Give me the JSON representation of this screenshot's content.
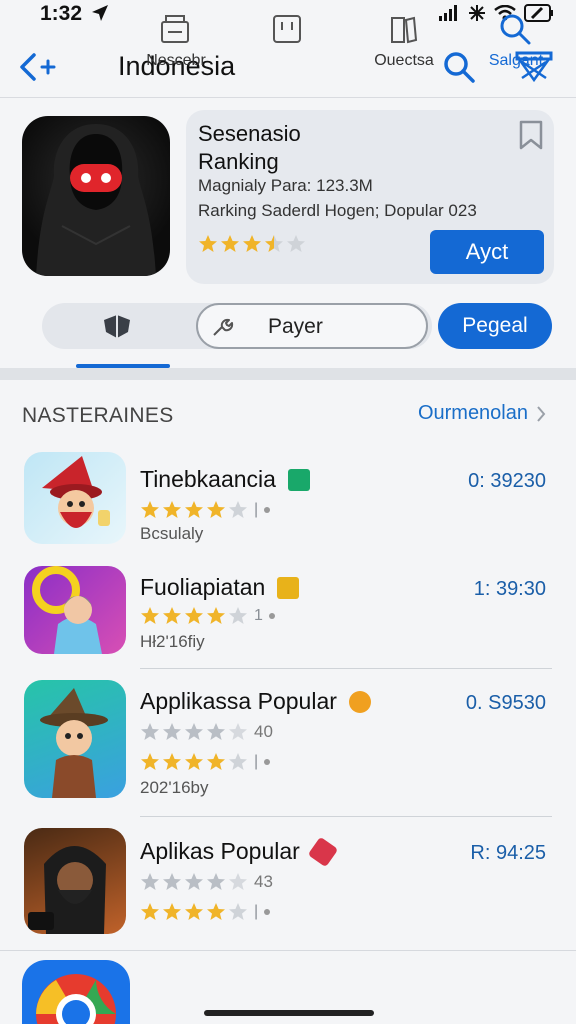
{
  "status": {
    "time": "1:32"
  },
  "nav": {
    "title": "Indonesia"
  },
  "hero": {
    "title": "Sesenasio\nRanking",
    "meta1": "Magnialy Para: 123.3M",
    "meta2": "Rarking Saderdl Hogen; Dopular 023",
    "rating": 3.5,
    "action_label": "Ayct"
  },
  "segment": {
    "middle_label": "Payer",
    "primary_label": "Pegeal"
  },
  "section": {
    "heading": "NASTERAINES",
    "link_label": "Ourmenolan"
  },
  "apps": [
    {
      "title": "Tinebkaancia",
      "value": "0: 39230",
      "sub": "Bcsulaly",
      "rating": 4,
      "extra_rating": null,
      "extra_text": "",
      "badge_color": "#19a86a"
    },
    {
      "title": "Fuoliapiatan",
      "value": "1: 39:30",
      "sub": "Hł2'16fiy",
      "rating": 4,
      "extra_rating": null,
      "extra_text": "",
      "badge_color": "#e8b21a"
    },
    {
      "title": "Applikassa Popular",
      "value": "0. S9530",
      "sub": "202'16by",
      "rating": 4,
      "extra_rating": 4,
      "extra_text": "40",
      "badge_color": "#f0a020"
    },
    {
      "title": "Aplikas Popular",
      "value": "R: 94:25",
      "sub": "",
      "rating": 4,
      "extra_rating": 4,
      "extra_text": "43",
      "badge_color": "#d9364a"
    }
  ],
  "tabs": [
    {
      "label": "Nescebr",
      "icon": "storefront-icon"
    },
    {
      "label": "",
      "icon": "calendar-icon"
    },
    {
      "label": "Ouectsa",
      "icon": "books-icon"
    },
    {
      "label": "Salgant",
      "icon": "search-icon"
    }
  ],
  "colors": {
    "accent": "#1469d4",
    "star": "#f0b429",
    "star_empty": "#cfd3d8"
  }
}
